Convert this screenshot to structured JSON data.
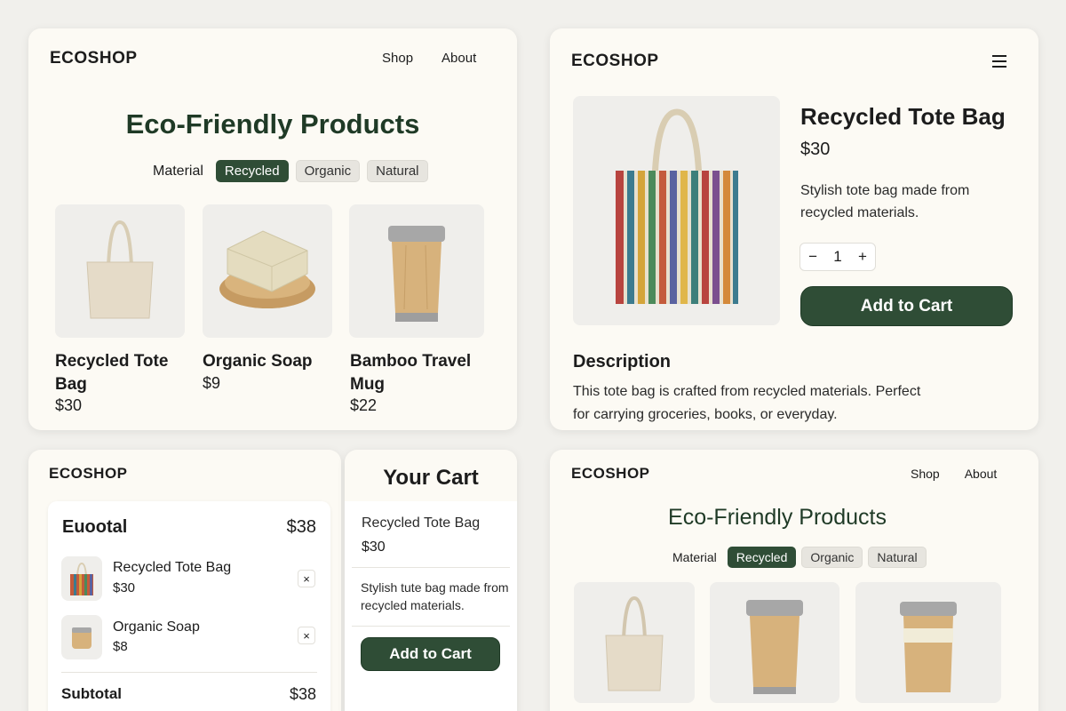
{
  "brand": "ECOSHOP",
  "colors": {
    "accent": "#2f4d36",
    "card_bg": "#fcfaf4",
    "page_bg": "#f1f0ec"
  },
  "panel1": {
    "nav": [
      "Shop",
      "About"
    ],
    "title": "Eco-Friendly Products",
    "filter_label": "Material",
    "filters": [
      "Recycled",
      "Organic",
      "Natural"
    ],
    "active_filter": "Recycled",
    "products": [
      {
        "name": "Recycled Tote Bag",
        "price": "$30",
        "image": "tote-bag-image"
      },
      {
        "name": "Organic Soap",
        "price": "$9",
        "image": "soap-image"
      },
      {
        "name": "Bamboo Travel Mug",
        "price": "$22",
        "image": "mug-image"
      }
    ]
  },
  "panel2": {
    "menu_icon": "hamburger-icon",
    "product_name": "Recycled Tote Bag",
    "price": "$30",
    "short_desc": "Stylish tote bag made from recycled materials.",
    "quantity": "1",
    "minus": "−",
    "plus": "+",
    "add_to_cart": "Add to Cart",
    "desc_heading": "Description",
    "desc_text": "This tote bag is crafted from recycled materials. Perfect for carrying groceries, books, or everyday."
  },
  "panel3": {
    "summary_label": "Euootal",
    "summary_value": "$38",
    "items": [
      {
        "name": "Recycled Tote Bag",
        "price": "$30",
        "remove": "×"
      },
      {
        "name": "Organic Soap",
        "price": "$8",
        "remove": "×"
      }
    ],
    "subtotal_label": "Subtotal",
    "subtotal_value": "$38"
  },
  "panel4": {
    "title": "Your Cart",
    "item_name": "Recycled Tote Bag",
    "item_price": "$30",
    "item_desc": "Stylish tute  bag made from recycled materials.",
    "add_to_cart": "Add to Cart"
  },
  "panel5": {
    "nav": [
      "Shop",
      "About"
    ],
    "title": "Eco-Friendly Products",
    "filter_label": "Material",
    "filters": [
      "Recycled",
      "Organic",
      "Natural"
    ],
    "active_filter": "Recycled"
  }
}
